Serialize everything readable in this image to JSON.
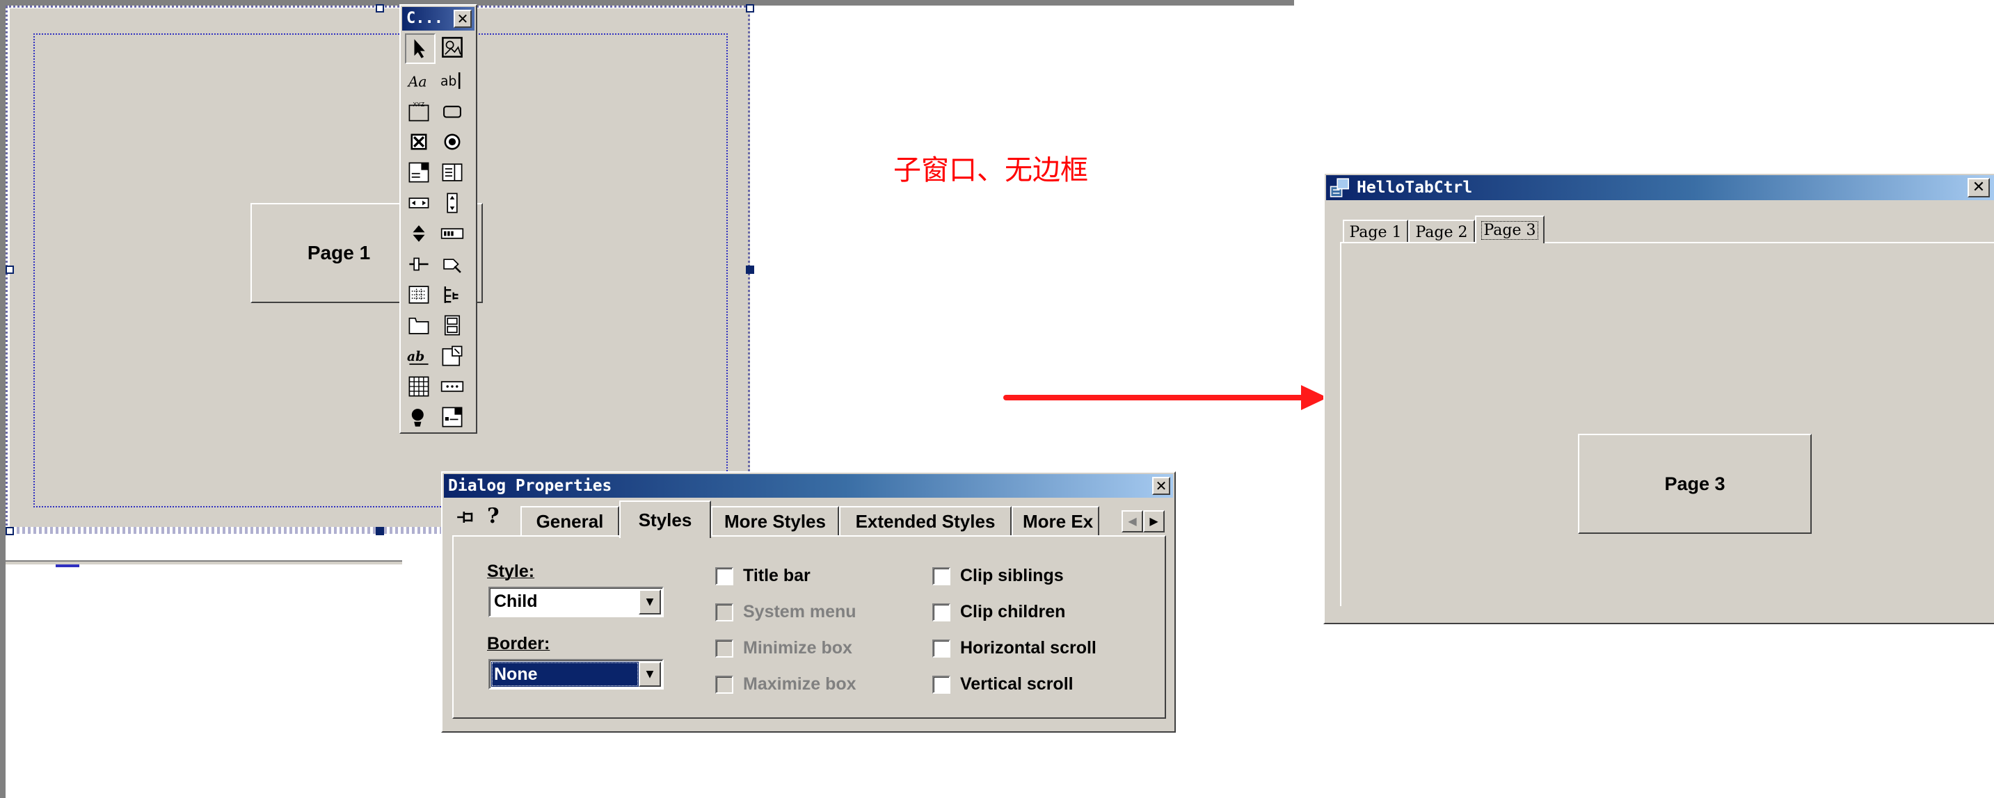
{
  "toolbox": {
    "title": "C...",
    "tools": [
      "pointer-icon",
      "picture-icon",
      "static-text-icon",
      "edit-box-icon",
      "group-box-icon",
      "button-icon",
      "checkbox-icon",
      "radio-button-icon",
      "combo-box-icon",
      "list-box-icon",
      "horizontal-scrollbar-icon",
      "vertical-scrollbar-icon",
      "spin-icon",
      "progress-icon",
      "slider-icon",
      "hotkey-icon",
      "list-control-icon",
      "tree-control-icon",
      "tab-control-icon",
      "animate-icon",
      "rich-edit-icon",
      "date-time-picker-icon",
      "month-calendar-icon",
      "ip-address-icon",
      "custom-control-icon",
      "extended-combo-icon"
    ]
  },
  "editor": {
    "page_label": "Page 1"
  },
  "annotation": {
    "text": "子窗口、无边框",
    "color": "#ff0000"
  },
  "properties_dialog": {
    "title": "Dialog Properties",
    "tabs": [
      "General",
      "Styles",
      "More Styles",
      "Extended Styles",
      "More Ex"
    ],
    "active_tab": "Styles",
    "style_label": "Style:",
    "style_value": "Child",
    "border_label": "Border:",
    "border_value": "None",
    "checkboxes_mid": [
      {
        "label": "Title bar",
        "enabled": true,
        "checked": false
      },
      {
        "label": "System menu",
        "enabled": false,
        "checked": false
      },
      {
        "label": "Minimize box",
        "enabled": false,
        "checked": false
      },
      {
        "label": "Maximize box",
        "enabled": false,
        "checked": false
      }
    ],
    "checkboxes_right": [
      {
        "label": "Clip siblings",
        "enabled": true,
        "checked": false
      },
      {
        "label": "Clip children",
        "enabled": true,
        "checked": false
      },
      {
        "label": "Horizontal scroll",
        "enabled": true,
        "checked": false
      },
      {
        "label": "Vertical scroll",
        "enabled": true,
        "checked": false
      }
    ]
  },
  "hello_window": {
    "title": "HelloTabCtrl",
    "tabs": [
      "Page 1",
      "Page 2",
      "Page 3"
    ],
    "active_tab": "Page 3",
    "page_label": "Page 3"
  },
  "colors": {
    "dialog_face": "#d4d0c8",
    "title_start": "#0a246a",
    "title_end": "#a6caf0",
    "arrow": "#ff1a1a"
  }
}
